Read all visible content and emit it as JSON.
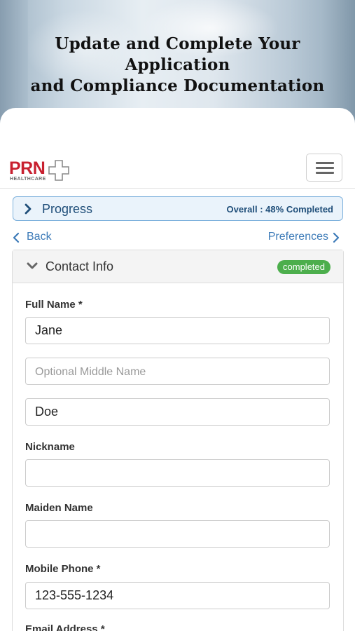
{
  "hero": {
    "title_line1": "Update and Complete Your Application",
    "title_line2": "and Compliance Documentation"
  },
  "header": {
    "logo_text": "PRN",
    "logo_subtext": "HEALTHCARE",
    "menu_icon": "hamburger-menu-icon"
  },
  "progress": {
    "label": "Progress",
    "overall_text": "Overall : 48% Completed",
    "percent": 48
  },
  "subnav": {
    "back_label": "Back",
    "preferences_label": "Preferences"
  },
  "section": {
    "title": "Contact Info",
    "status_badge": "completed",
    "status_color": "#4cae4c"
  },
  "form": {
    "full_name_label": "Full Name *",
    "first_name_value": "Jane",
    "middle_name_placeholder": "Optional Middle Name",
    "last_name_value": "Doe",
    "nickname_label": "Nickname",
    "nickname_value": "",
    "maiden_name_label": "Maiden Name",
    "maiden_name_value": "",
    "mobile_phone_label": "Mobile Phone *",
    "mobile_phone_value": "123-555-1234",
    "email_label": "Email Address *"
  },
  "colors": {
    "brand_red": "#c8202f",
    "link_blue": "#3d7bb8",
    "progress_navy": "#1f4e79"
  }
}
